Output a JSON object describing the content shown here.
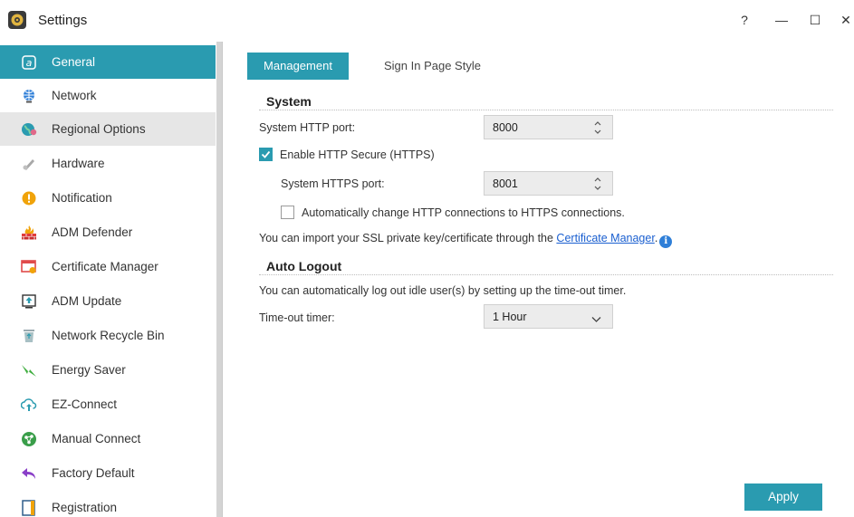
{
  "window": {
    "title": "Settings",
    "icon": "gear-icon",
    "controls": {
      "help": "?",
      "minimize": "—",
      "maximize": "☐",
      "close": "✕"
    }
  },
  "sidebar": {
    "items": [
      {
        "label": "General",
        "icon": "general-icon",
        "state": "active"
      },
      {
        "label": "Network",
        "icon": "globe-icon",
        "state": "normal"
      },
      {
        "label": "Regional Options",
        "icon": "world-icon",
        "state": "hover"
      },
      {
        "label": "Hardware",
        "icon": "hardware-icon",
        "state": "normal"
      },
      {
        "label": "Notification",
        "icon": "exclamation-icon",
        "state": "normal"
      },
      {
        "label": "ADM Defender",
        "icon": "firewall-icon",
        "state": "normal"
      },
      {
        "label": "Certificate Manager",
        "icon": "certificate-icon",
        "state": "normal"
      },
      {
        "label": "ADM Update",
        "icon": "update-icon",
        "state": "normal"
      },
      {
        "label": "Network Recycle Bin",
        "icon": "recycle-bin-icon",
        "state": "normal"
      },
      {
        "label": "Energy Saver",
        "icon": "energy-icon",
        "state": "normal"
      },
      {
        "label": "EZ-Connect",
        "icon": "cloud-upload-icon",
        "state": "normal"
      },
      {
        "label": "Manual Connect",
        "icon": "network-nodes-icon",
        "state": "normal"
      },
      {
        "label": "Factory Default",
        "icon": "undo-arrow-icon",
        "state": "normal"
      },
      {
        "label": "Registration",
        "icon": "registration-icon",
        "state": "normal"
      }
    ]
  },
  "tabs": [
    {
      "label": "Management",
      "active": true
    },
    {
      "label": "Sign In Page Style",
      "active": false
    }
  ],
  "system": {
    "title": "System",
    "http_port_label": "System HTTP port:",
    "http_port_value": "8000",
    "https_enable_label": "Enable HTTP Secure (HTTPS)",
    "https_enabled": true,
    "https_port_label": "System HTTPS port:",
    "https_port_value": "8001",
    "auto_redirect_label": "Automatically change HTTP connections to HTTPS connections.",
    "auto_redirect_checked": false,
    "ssl_text": "You can import your SSL private key/certificate through the ",
    "ssl_link": "Certificate Manager",
    "ssl_suffix": ".",
    "info_icon": "i"
  },
  "auto_logout": {
    "title": "Auto Logout",
    "description": "You can automatically log out idle user(s) by setting up the time-out timer.",
    "timer_label": "Time-out timer:",
    "timer_value": "1 Hour"
  },
  "footer": {
    "apply_label": "Apply"
  },
  "colors": {
    "accent": "#2a9bb0",
    "link": "#1a5fd0",
    "hover": "#e6e6e6"
  }
}
